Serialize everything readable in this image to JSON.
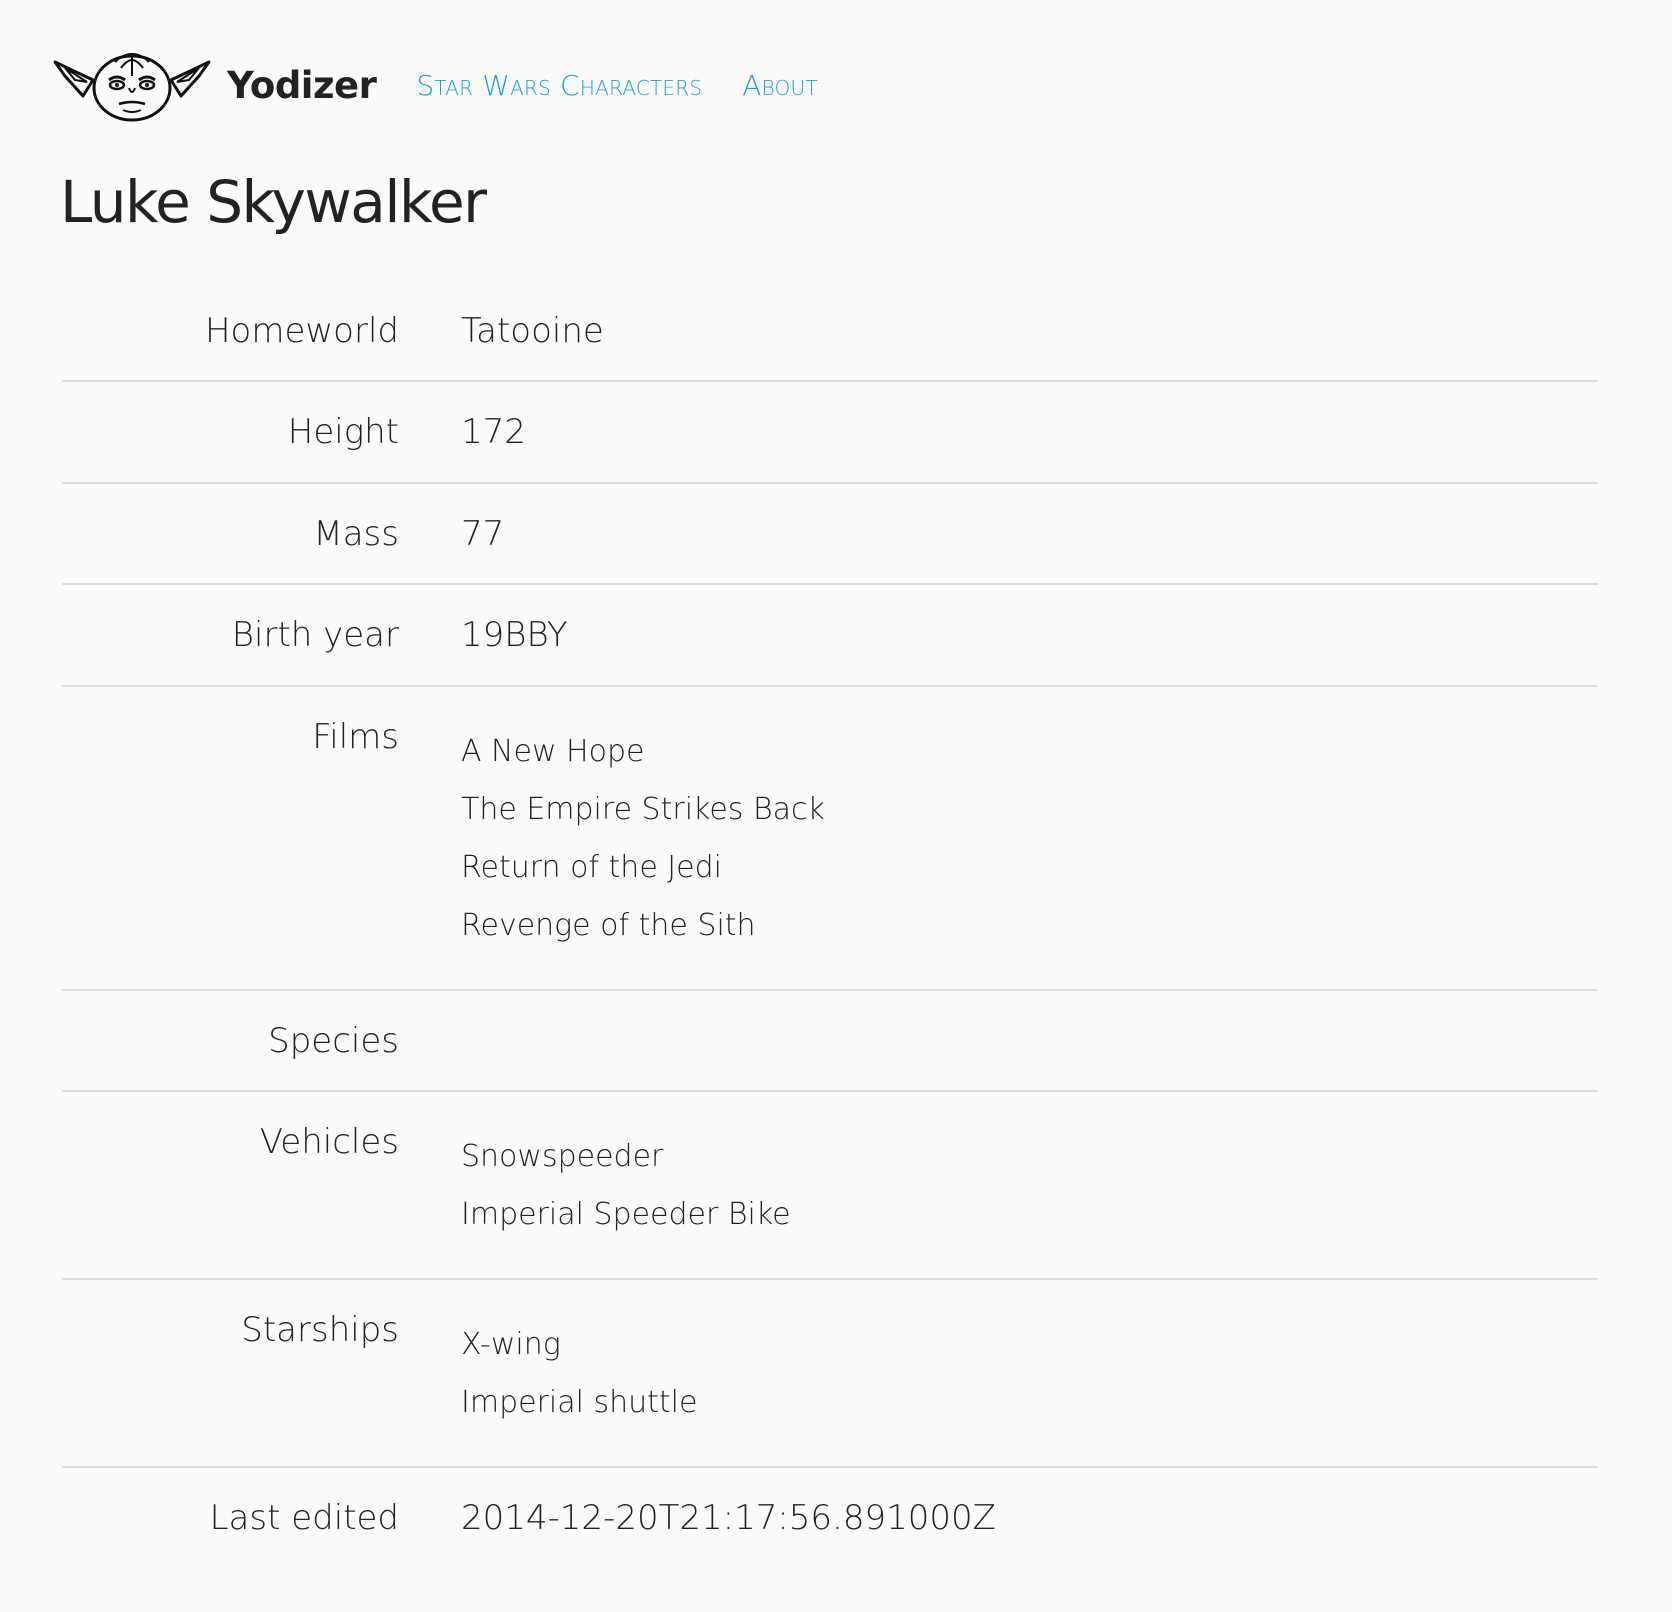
{
  "app": {
    "name": "Yodizer",
    "logo_icon": "yoda-head-icon"
  },
  "nav": {
    "items": [
      {
        "label": "Star Wars Characters"
      },
      {
        "label": "About"
      }
    ]
  },
  "character": {
    "name": "Luke Skywalker",
    "fields": {
      "homeworld": {
        "label": "Homeworld",
        "value": "Tatooine"
      },
      "height": {
        "label": "Height",
        "value": "172"
      },
      "mass": {
        "label": "Mass",
        "value": "77"
      },
      "birth_year": {
        "label": "Birth year",
        "value": "19BBY"
      },
      "films": {
        "label": "Films",
        "items": [
          "A New Hope",
          "The Empire Strikes Back",
          "Return of the Jedi",
          "Revenge of the Sith"
        ]
      },
      "species": {
        "label": "Species",
        "items": []
      },
      "vehicles": {
        "label": "Vehicles",
        "items": [
          "Snowspeeder",
          "Imperial Speeder Bike"
        ]
      },
      "starships": {
        "label": "Starships",
        "items": [
          "X-wing",
          "Imperial shuttle"
        ]
      },
      "last_edited": {
        "label": "Last edited",
        "value": "2014-12-20T21:17:56.891000Z"
      }
    }
  },
  "colors": {
    "link": "#1a9fd0",
    "text": "#222222",
    "divider": "#dddddd",
    "background": "#fafafa"
  }
}
